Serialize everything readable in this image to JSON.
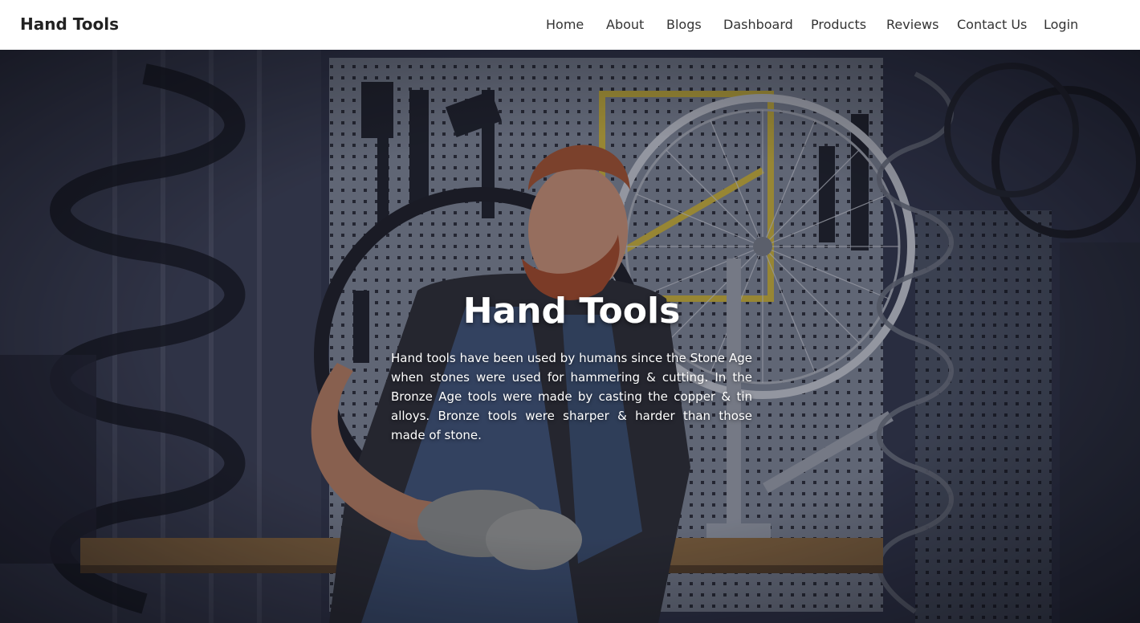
{
  "navbar": {
    "brand": "Hand Tools",
    "links": [
      {
        "label": "Home"
      },
      {
        "label": "About"
      },
      {
        "label": "Blogs"
      },
      {
        "label": "Dashboard"
      },
      {
        "label": "Products"
      },
      {
        "label": "Reviews"
      },
      {
        "label": "Contact Us"
      },
      {
        "label": "Login"
      }
    ]
  },
  "hero": {
    "title": "Hand Tools",
    "description": "Hand tools have been used by humans since the Stone Age when stones were used for hammering & cutting. In the Bronze Age tools were made by casting the copper & tin alloys. Bronze tools were sharper & harder than those made of stone."
  },
  "colors": {
    "navbar_bg": "#ffffff",
    "nav_text": "#333333",
    "hero_text": "#ffffff",
    "hero_overlay": "#1a1d2e"
  }
}
